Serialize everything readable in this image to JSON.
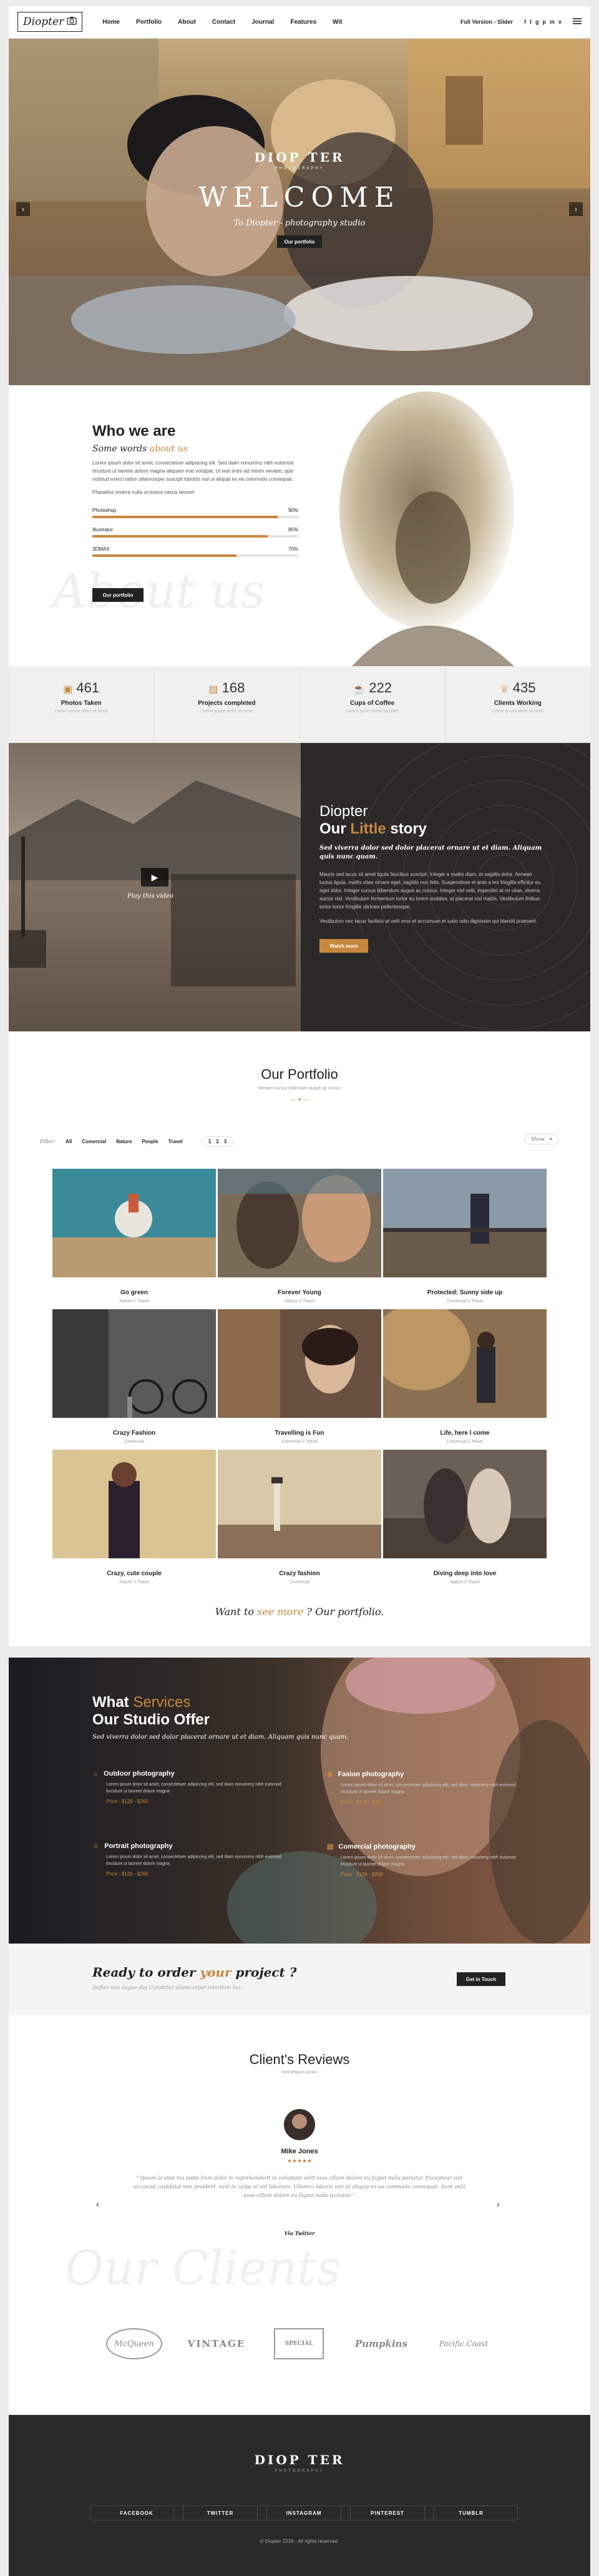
{
  "header": {
    "logo_text": "Diopter",
    "nav": [
      "Home",
      "Portfolio",
      "About",
      "Contact",
      "Journal",
      "Features",
      "Wit"
    ],
    "version_label": "Full Version - Slider",
    "social": [
      "f",
      "t",
      "g",
      "p",
      "in",
      "v"
    ],
    "menu_icon": "hamburger-icon"
  },
  "hero": {
    "brand": "DIOP TER",
    "brand_sub": "PHOTOGRAPHY",
    "welcome": "WELCOME",
    "tagline": "To Diopter - photography studio",
    "button": "Our portfolio"
  },
  "who": {
    "title": "Who we are",
    "subtitle_a": "Some words",
    "subtitle_b": "about us",
    "paragraph1": "Lorem ipsum dolor sit amet, consectetuer adipiscing elit. Sed diam nonummy nibh euismod tincidunt ut laoreet dolore magna aliquam erat volutpat. Ut wisi enim ad minim veniam, quis nostrud exerci tation ullamcorper suscipit lobortis nisl ut aliquip ex ea commodo consequat.",
    "paragraph2": "Phasellus viverra nulla ut metus varius laoreet.",
    "skills": [
      {
        "label": "Photoshop",
        "pct": "90%",
        "value": 0.9
      },
      {
        "label": "Illustrator",
        "pct": "85%",
        "value": 0.85
      },
      {
        "label": "3DMAX",
        "pct": "70%",
        "value": 0.7
      }
    ],
    "button": "Our portfolio",
    "watermark": "About us"
  },
  "stats": [
    {
      "num": "461",
      "label": "Photos Taken",
      "sub": "Lorem ipsum dolor sit amet",
      "icon": "image-icon"
    },
    {
      "num": "168",
      "label": "Projects completed",
      "sub": "Lorem ipsum dolor sit amet",
      "icon": "briefcase-icon"
    },
    {
      "num": "222",
      "label": "Cups of Coffee",
      "sub": "Lorem ipsum dolor sit amet",
      "icon": "coffee-icon"
    },
    {
      "num": "435",
      "label": "Clients Working",
      "sub": "Lorem ipsum dolor sit amet",
      "icon": "trophy-icon"
    }
  ],
  "story": {
    "video_caption": "Play this video",
    "title_line1": "Diopter",
    "title_our": "Our",
    "title_little": "Little",
    "title_story": "story",
    "italic": "Sed viverra dolor sed dolor placerat ornare ut et diam. Aliquam quis nunc quam.",
    "paragraph1": "Mauris sed lacus sit amet ligula faucibus suscipit. Integer a mattis diam, et sagittis dolor. Aenean luctus ligula, mattis vitae ornare eget, sagittis non felis. Suspendisse et ante a leo fringilla efficitur eu eget dolor. Integer cursus bibendum augue ac cursus. Integer nisl velit, imperdiet at mi vitae, viverra auctor nisl. Vestibulum fermentum tortor eu lorem sodales, at placerat nisl mattis. Vestibulum finibus tortor tortor fringilla ultricies pellentesque.",
    "paragraph2": "Vestibulum nec lacus facilisis at velit eros et accumsan et iusto odio dignissim qui blandit praesent.",
    "button": "Watch more"
  },
  "portfolio": {
    "title": "Our Portfolio",
    "subtitle": "Semper cursus bibendum augue ac cursus",
    "filter_label": "Filter:",
    "filters": [
      "All",
      "Comercial",
      "Nature",
      "People",
      "Travel"
    ],
    "pages": [
      "1",
      "2",
      "3"
    ],
    "sort": "Show",
    "items": [
      {
        "title": "Go green",
        "sub": "Nature // Travel"
      },
      {
        "title": "Forever Young",
        "sub": "Nature // Travel"
      },
      {
        "title": "Protected: Sunny side up",
        "sub": "Comercial // Travel"
      },
      {
        "title": "Crazy Fashion",
        "sub": "Comercial"
      },
      {
        "title": "Travelling is Fun",
        "sub": "Comercial // Travel"
      },
      {
        "title": "Life, here I come",
        "sub": "Comercial // Travel"
      },
      {
        "title": "Crazy, cute couple",
        "sub": "Nature // Travel"
      },
      {
        "title": "Crazy fashion",
        "sub": "Comercial"
      },
      {
        "title": "Diving deep into love",
        "sub": "Nature // Travel"
      }
    ],
    "more_a": "Want to",
    "more_b": "see more",
    "more_c": "? Our portfolio."
  },
  "services": {
    "title_a": "What",
    "title_b": "Services",
    "title_c": "Our Studio Offer",
    "italic": "Sed viverra dolor sed dolor placerat ornare ut et diam. Aliquam quis nunc quam.",
    "items": [
      {
        "title": "Outdoor photography",
        "icon": "sun-icon",
        "desc": "Lorem ipsum dolor sit amet, consectetuer adipiscing elit, sed diam nonummy nibh euismod tincidunt ut laoreet dolore magna.",
        "price": "Price : $126 - $260"
      },
      {
        "title": "Fasion photography",
        "icon": "camera-icon",
        "desc": "Lorem ipsum dolor sit amet, consectetuer adipiscing elit, sed diam nonummy nibh euismod tincidunt ut laoreet dolore magna.",
        "price": "Price : $126 - $260"
      },
      {
        "title": "Portrait photography",
        "icon": "user-icon",
        "desc": "Lorem ipsum dolor sit amet, consectetuer adipiscing elit, sed diam nonummy nibh euismod tincidunt ut laoreet dolore magna.",
        "price": "Price : $126 - $260"
      },
      {
        "title": "Comercial photography",
        "icon": "briefcase-icon",
        "desc": "Lorem ipsum dolor sit amet, consectetuer adipiscing elit, sed diam nonummy nibh euismod tincidunt ut laoreet dolore magna.",
        "price": "Price : $126 - $260"
      }
    ]
  },
  "order": {
    "title_a": "Ready to order",
    "title_b": "your",
    "title_c": "project ?",
    "sub": "Duftes non augue das Curabitur ullamcorper interdum leo.",
    "button": "Get in Touch"
  },
  "reviews": {
    "title": "Client's Reviews",
    "subtitle": "Sed tempus luctus",
    "name": "Mike Jones",
    "stars": "★★★★★",
    "quote": "\" Ipsum lo ante ma tante lrem dolor in reprehenderit in voluptate velit esse cillum dolore eu fugiat nulla pariatur. Excepteur sint occaecat cupidatat non proident, sunt in culpa ut est laborum. Ullamco laboris nisi ut aliquip ex ea commodo consequat. Sunt velit esse cillum dolore eu fugiat nulla pariatur. \"",
    "via": "Via Twitter",
    "clients_watermark": "Our Clients",
    "clients": [
      "McQueen",
      "VINTAGE",
      "SPECIAL",
      "Pumpkins",
      "Pacific Coast"
    ]
  },
  "footer": {
    "brand": "DIOP TER",
    "brand_sub": "PHOTOGRAPHY",
    "socials": [
      "FACEBOOK",
      "TWITTER",
      "INSTAGRAM",
      "PINTEREST",
      "TUMBLR"
    ],
    "copyright": "© Diopter 2016 . All rights reserved."
  },
  "colors": {
    "accent": "#c8873f",
    "dark": "#2c2a28",
    "footer": "#2a2a2a"
  }
}
